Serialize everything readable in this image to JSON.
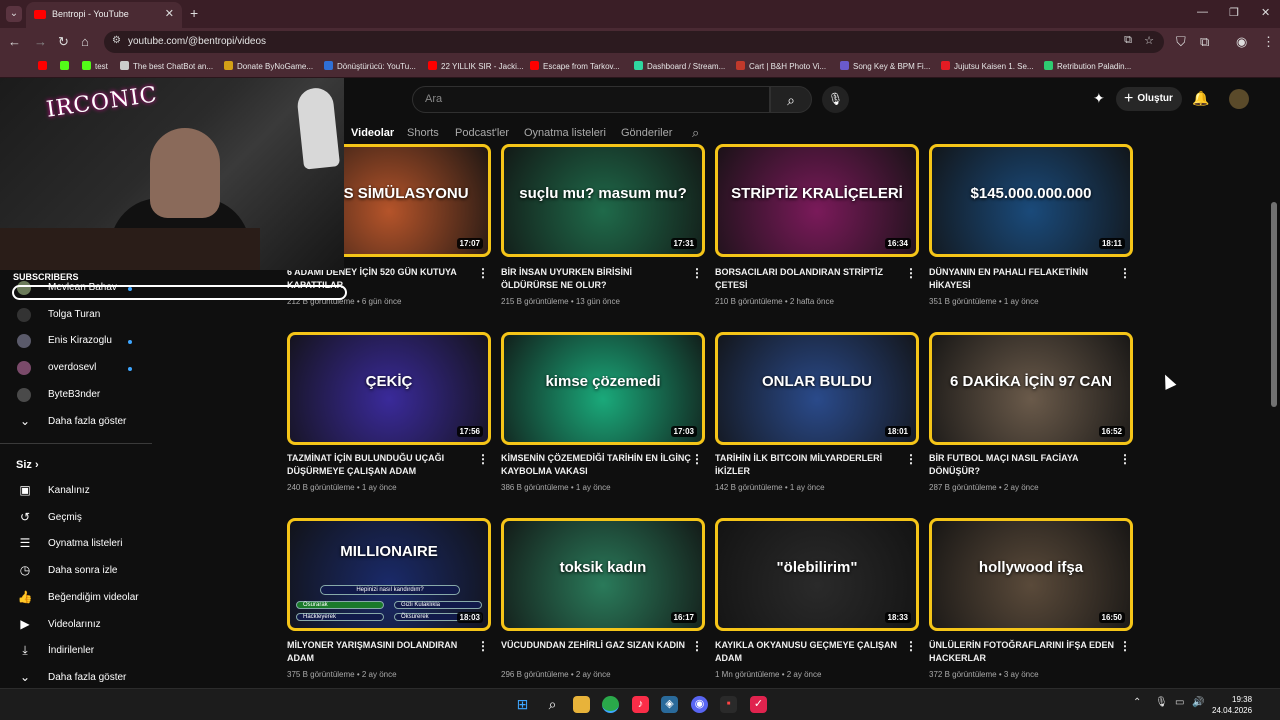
{
  "browser": {
    "tab_title": "Bentropi - YouTube",
    "tab_close": "✕",
    "new_tab": "+",
    "url": "youtube.com/@bentropi/videos",
    "bookmarks": [
      {
        "label": "",
        "color": "#ff0000"
      },
      {
        "label": "",
        "color": "#53fc18"
      },
      {
        "label": "test",
        "color": "#53fc18"
      },
      {
        "label": "The best ChatBot an...",
        "color": "#cccccc"
      },
      {
        "label": "Donate ByNoGame...",
        "color": "#d4a017"
      },
      {
        "label": "Dönüştürücü: YouTu...",
        "color": "#2f6fd6"
      },
      {
        "label": "22 YILLIK SIR - Jacki...",
        "color": "#ff0000"
      },
      {
        "label": "Escape from Tarkov...",
        "color": "#ff0000"
      },
      {
        "label": "Dashboard / Stream...",
        "color": "#2fd6a0"
      },
      {
        "label": "Cart | B&H Photo Vi...",
        "color": "#c0392b"
      },
      {
        "label": "Song Key & BPM Fi...",
        "color": "#6a5acd"
      },
      {
        "label": "Jujutsu Kaisen 1. Se...",
        "color": "#e31b23"
      },
      {
        "label": "Retribution Paladin...",
        "color": "#2ecc71"
      }
    ]
  },
  "header": {
    "search_placeholder": "Ara",
    "create_label": "Oluştur"
  },
  "channel_tabs": [
    "Videolar",
    "Shorts",
    "Podcast'ler",
    "Oynatma listeleri",
    "Gönderiler"
  ],
  "webcam": {
    "neon_text": "IRCONIC"
  },
  "sidebar": {
    "subscribers_heading": "SUBSCRIBERS",
    "subscriptions": [
      {
        "name": "Mevlean Bahav",
        "live": true,
        "color": "#6b7b5a"
      },
      {
        "name": "Tolga Turan",
        "live": false,
        "color": "#333333"
      },
      {
        "name": "Enis Kirazoglu",
        "live": true,
        "color": "#5a5a6a"
      },
      {
        "name": "overdosevl",
        "live": true,
        "color": "#7a4a6a"
      },
      {
        "name": "ByteB3nder",
        "live": false,
        "color": "#4a4a4a"
      }
    ],
    "show_more_subs": "Daha fazla göster",
    "you_heading": "Siz",
    "you_items": [
      {
        "label": "Kanalınız",
        "icon": "channel-icon",
        "glyph": "▣"
      },
      {
        "label": "Geçmiş",
        "icon": "history-icon",
        "glyph": "↺"
      },
      {
        "label": "Oynatma listeleri",
        "icon": "playlists-icon",
        "glyph": "☰"
      },
      {
        "label": "Daha sonra izle",
        "icon": "watch-later-icon",
        "glyph": "◷"
      },
      {
        "label": "Beğendiğim videolar",
        "icon": "like-icon",
        "glyph": "👍"
      },
      {
        "label": "Videolarınız",
        "icon": "your-videos-icon",
        "glyph": "▶"
      },
      {
        "label": "İndirilenler",
        "icon": "download-icon",
        "glyph": "⤓"
      },
      {
        "label": "Daha fazla göster",
        "icon": "chevron-down-icon",
        "glyph": "⌄"
      }
    ]
  },
  "videos": [
    {
      "title": "6 ADAMI DENEY İÇİN 520 GÜN KUTUYA KAPATTILAR",
      "views": "212 B görüntüleme",
      "age": "6 gün önce",
      "duration": "17:07",
      "thumb_text": "MARS SİMÜLASYONU",
      "bg": "#b5542a"
    },
    {
      "title": "BİR İNSAN UYURKEN BİRİSİNİ ÖLDÜRÜRSE NE OLUR?",
      "views": "215 B görüntüleme",
      "age": "13 gün önce",
      "duration": "17:31",
      "thumb_text": "suçlu mu? masum mu?",
      "bg": "#1f6a4a"
    },
    {
      "title": "BORSACILARI DOLANDIRAN STRİPTİZ ÇETESİ",
      "views": "210 B görüntüleme",
      "age": "2 hafta önce",
      "duration": "16:34",
      "thumb_text": "STRİPTİZ KRALİÇELERİ",
      "bg": "#7a1a5a"
    },
    {
      "title": "DÜNYANIN EN PAHALI FELAKETİNİN HİKAYESİ",
      "views": "351 B görüntüleme",
      "age": "1 ay önce",
      "duration": "18:11",
      "thumb_text": "$145.000.000.000",
      "bg": "#1a4a7a"
    },
    {
      "title": "TAZMİNAT İÇİN BULUNDUĞU UÇAĞI DÜŞÜRMEYE ÇALIŞAN ADAM",
      "views": "240 B görüntüleme",
      "age": "1 ay önce",
      "duration": "17:56",
      "thumb_text": "ÇEKİÇ",
      "bg": "#3a2a9a"
    },
    {
      "title": "KİMSENİN ÇÖZEMEDİĞİ TARİHİN EN İLGİNÇ KAYBOLMA VAKASI",
      "views": "386 B görüntüleme",
      "age": "1 ay önce",
      "duration": "17:03",
      "thumb_text": "kimse çözemedi",
      "bg": "#1aa97a"
    },
    {
      "title": "TARİHİN İLK BITCOIN MİLYARDERLERİ İKİZLER",
      "views": "142 B görüntüleme",
      "age": "1 ay önce",
      "duration": "18:01",
      "thumb_text": "ONLAR BULDU",
      "bg": "#2a4a8a"
    },
    {
      "title": "BİR FUTBOL MAÇI NASIL FACİAYA DÖNÜŞÜR?",
      "views": "287 B görüntüleme",
      "age": "2 ay önce",
      "duration": "16:52",
      "thumb_text": "6 DAKİKA İÇİN 97 CAN",
      "bg": "#6a5a4a"
    },
    {
      "title": "MİLYONER YARIŞMASINI DOLANDIRAN ADAM",
      "views": "375 B görüntüleme",
      "age": "2 ay önce",
      "duration": "18:03",
      "thumb_text": "MILLIONAIRE",
      "bg": "#1a2a6a"
    },
    {
      "title": "VÜCUDUNDAN ZEHİRLİ GAZ SIZAN KADIN",
      "views": "296 B görüntüleme",
      "age": "2 ay önce",
      "duration": "16:17",
      "thumb_text": "toksik kadın",
      "bg": "#2a7a5a"
    },
    {
      "title": "KAYIKLA OKYANUSU GEÇMEYE ÇALIŞAN ADAM",
      "views": "1 Mn görüntüleme",
      "age": "2 ay önce",
      "duration": "18:33",
      "thumb_text": "\"ölebilirim\"",
      "bg": "#2a2a2a"
    },
    {
      "title": "ÜNLÜLERİN FOTOĞRAFLARINI İFŞA EDEN HACKERLAR",
      "views": "372 B görüntüleme",
      "age": "3 ay önce",
      "duration": "16:50",
      "thumb_text": "hollywood ifşa",
      "bg": "#5a4a3a"
    }
  ],
  "millionaire_overlay": {
    "question": "Hepinizi nasıl kandırdım?",
    "answers": [
      "Osurarak",
      "Gizli Kulaklıkla",
      "Hackleyerek",
      "Öksürerek"
    ]
  },
  "taskbar": {
    "time": "19:38",
    "date": "24.04.2026"
  }
}
